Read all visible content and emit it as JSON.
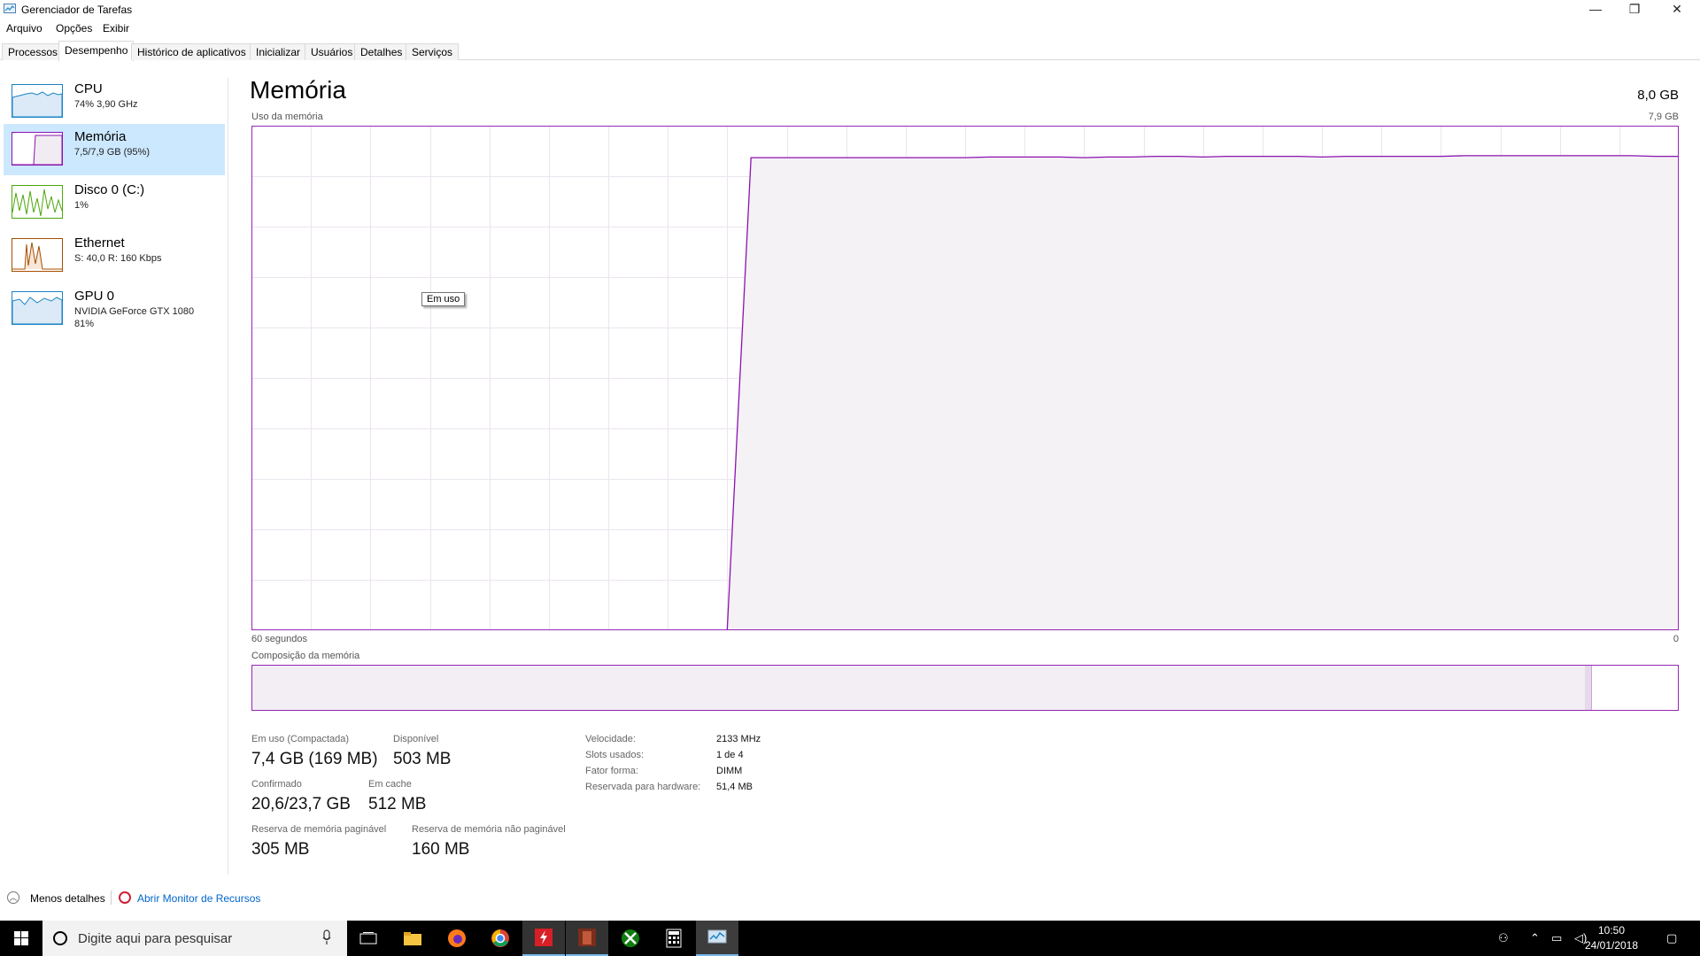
{
  "window": {
    "title": "Gerenciador de Tarefas",
    "minimize_glyph": "—",
    "restore_glyph": "❐",
    "close_glyph": "✕"
  },
  "menu": [
    "Arquivo",
    "Opções",
    "Exibir"
  ],
  "tabs": [
    {
      "label": "Processos",
      "active": false
    },
    {
      "label": "Desempenho",
      "active": true
    },
    {
      "label": "Histórico de aplicativos",
      "active": false
    },
    {
      "label": "Inicializar",
      "active": false
    },
    {
      "label": "Usuários",
      "active": false
    },
    {
      "label": "Detalhes",
      "active": false
    },
    {
      "label": "Serviços",
      "active": false
    }
  ],
  "sidebar": [
    {
      "title": "CPU",
      "line1": "74%  3,90 GHz",
      "line2": "",
      "color": "#1b83c5",
      "selected": false
    },
    {
      "title": "Memória",
      "line1": "7,5/7,9 GB (95%)",
      "line2": "",
      "color": "#8b12ae",
      "selected": true
    },
    {
      "title": "Disco 0 (C:)",
      "line1": "1%",
      "line2": "",
      "color": "#4da60c",
      "selected": false
    },
    {
      "title": "Ethernet",
      "line1": "S: 40,0  R: 160 Kbps",
      "line2": "",
      "color": "#a74f01",
      "selected": false
    },
    {
      "title": "GPU 0",
      "line1": "NVIDIA GeForce GTX 1080",
      "line2": "81%",
      "color": "#1b83c5",
      "selected": false
    }
  ],
  "main": {
    "title": "Memória",
    "total": "8,0 GB",
    "usage_label": "Uso da memória",
    "usage_max": "7,9 GB",
    "axis_left": "60 segundos",
    "axis_right": "0",
    "composition_label": "Composição da memória",
    "tooltip": "Em uso",
    "composition": {
      "in_use_fraction": 0.935,
      "modified_fraction": 0.004
    }
  },
  "stats": {
    "in_use_label": "Em uso (Compactada)",
    "in_use_value": "7,4 GB (169 MB)",
    "available_label": "Disponível",
    "available_value": "503 MB",
    "committed_label": "Confirmado",
    "committed_value": "20,6/23,7 GB",
    "cached_label": "Em cache",
    "cached_value": "512 MB",
    "paged_label": "Reserva de memória paginável",
    "paged_value": "305 MB",
    "nonpaged_label": "Reserva de memória não paginável",
    "nonpaged_value": "160 MB"
  },
  "specs": [
    {
      "label": "Velocidade:",
      "value": "2133 MHz"
    },
    {
      "label": "Slots usados:",
      "value": "1 de 4"
    },
    {
      "label": "Fator forma:",
      "value": "DIMM"
    },
    {
      "label": "Reservada para hardware:",
      "value": "51,4 MB"
    }
  ],
  "footer": {
    "fewer_details": "Menos detalhes",
    "resource_monitor": "Abrir Monitor de Recursos"
  },
  "taskbar": {
    "search_placeholder": "Digite aqui para pesquisar",
    "time": "10:50",
    "date": "24/01/2018",
    "apps": [
      "task-view-icon",
      "file-explorer-icon",
      "firefox-icon",
      "chrome-icon",
      "flash-app-icon",
      "game-app-icon",
      "xbox-icon",
      "calculator-icon",
      "task-manager-icon"
    ]
  },
  "chart_data": {
    "type": "area",
    "title": "",
    "xlabel": "",
    "ylabel": "",
    "x": [
      60,
      59,
      58,
      57,
      56,
      55,
      54,
      53,
      52,
      51,
      50,
      49,
      48,
      47,
      46,
      45,
      44,
      43,
      42,
      41,
      40,
      39,
      38,
      37,
      36,
      35,
      34,
      33,
      32,
      31,
      30,
      29,
      28,
      27,
      26,
      25,
      24,
      23,
      22,
      21,
      20,
      19,
      18,
      17,
      16,
      15,
      14,
      13,
      12,
      11,
      10,
      9,
      8,
      7,
      6,
      5,
      4,
      3,
      2,
      1,
      0
    ],
    "series": [
      {
        "values": [
          0,
          0,
          0,
          0,
          0,
          0,
          0,
          0,
          0,
          0,
          0,
          0,
          0,
          0,
          0,
          0,
          0,
          0,
          0,
          0,
          0,
          7.4,
          7.4,
          7.4,
          7.4,
          7.4,
          7.4,
          7.4,
          7.4,
          7.4,
          7.4,
          7.41,
          7.41,
          7.41,
          7.41,
          7.4,
          7.41,
          7.41,
          7.42,
          7.42,
          7.41,
          7.42,
          7.42,
          7.42,
          7.42,
          7.41,
          7.42,
          7.42,
          7.42,
          7.42,
          7.42,
          7.43,
          7.43,
          7.43,
          7.43,
          7.43,
          7.43,
          7.43,
          7.43,
          7.42,
          7.42
        ]
      }
    ],
    "ylim": [
      0,
      7.9
    ],
    "grid": true,
    "line_color": "#8b12ae",
    "fill_color": "#f4f2f5"
  }
}
